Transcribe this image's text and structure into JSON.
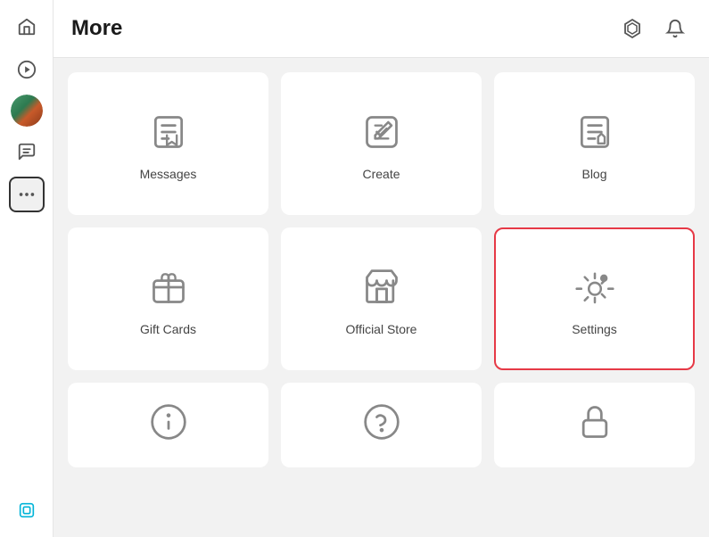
{
  "header": {
    "title": "More",
    "robux_icon": "robux-icon",
    "notification_icon": "bell-icon"
  },
  "sidebar": {
    "items": [
      {
        "id": "home",
        "label": "Home",
        "icon": "home-icon"
      },
      {
        "id": "discover",
        "label": "Discover",
        "icon": "play-icon"
      },
      {
        "id": "avatar",
        "label": "Avatar",
        "icon": "avatar-icon"
      },
      {
        "id": "chat",
        "label": "Chat",
        "icon": "chat-icon"
      },
      {
        "id": "more",
        "label": "More",
        "icon": "more-icon",
        "active": true
      }
    ],
    "bottom": [
      {
        "id": "robux",
        "label": "Robux",
        "icon": "robux-sidebar-icon"
      }
    ]
  },
  "grid": {
    "cards": [
      {
        "id": "messages",
        "label": "Messages",
        "icon": "messages-icon",
        "highlighted": false
      },
      {
        "id": "create",
        "label": "Create",
        "icon": "create-icon",
        "highlighted": false
      },
      {
        "id": "blog",
        "label": "Blog",
        "icon": "blog-icon",
        "highlighted": false
      },
      {
        "id": "gift-cards",
        "label": "Gift Cards",
        "icon": "gift-cards-icon",
        "highlighted": false
      },
      {
        "id": "official-store",
        "label": "Official Store",
        "icon": "official-store-icon",
        "highlighted": false
      },
      {
        "id": "settings",
        "label": "Settings",
        "icon": "settings-icon",
        "highlighted": true
      },
      {
        "id": "info",
        "label": "",
        "icon": "info-icon",
        "highlighted": false,
        "partial": true
      },
      {
        "id": "help",
        "label": "",
        "icon": "help-icon",
        "highlighted": false,
        "partial": true
      },
      {
        "id": "lock",
        "label": "",
        "icon": "lock-icon",
        "highlighted": false,
        "partial": true
      }
    ]
  }
}
